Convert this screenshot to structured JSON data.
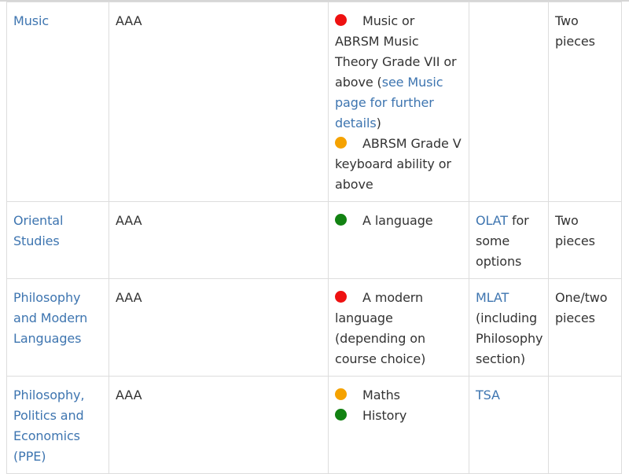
{
  "colors": {
    "link": "#3e75b0",
    "text": "#333333",
    "border": "#dddddd",
    "essential": "#ee1111",
    "recommended": "#f5a200",
    "helpful": "#128212"
  },
  "rows": [
    {
      "course": "Music",
      "grades": "AAA",
      "subjects": [
        {
          "level": "red",
          "text": "Music or ABRSM Music Theory Grade VII or above (",
          "link": "see Music page for further details",
          "text_after": ")"
        },
        {
          "level": "orange",
          "text": "ABRSM Grade V keyboard ability or above"
        }
      ],
      "test": "",
      "written_work": "Two pieces"
    },
    {
      "course": "Oriental Studies",
      "grades": "AAA",
      "subjects": [
        {
          "level": "green",
          "text": "A language"
        }
      ],
      "test_link": "OLAT",
      "test_text": " for some options",
      "written_work": "Two pieces"
    },
    {
      "course": "Philosophy and Modern Languages",
      "grades": "AAA",
      "subjects": [
        {
          "level": "red",
          "text": "A modern language (depending on course choice)"
        }
      ],
      "test_link": "MLAT",
      "test_text": " (including Philosophy section)",
      "written_work": "One/two pieces"
    },
    {
      "course": "Philosophy, Politics and Economics (PPE)",
      "grades": "AAA",
      "subjects": [
        {
          "level": "orange",
          "text": "Maths"
        },
        {
          "level": "green",
          "text": "History"
        }
      ],
      "test_link": "TSA",
      "written_work": ""
    }
  ]
}
